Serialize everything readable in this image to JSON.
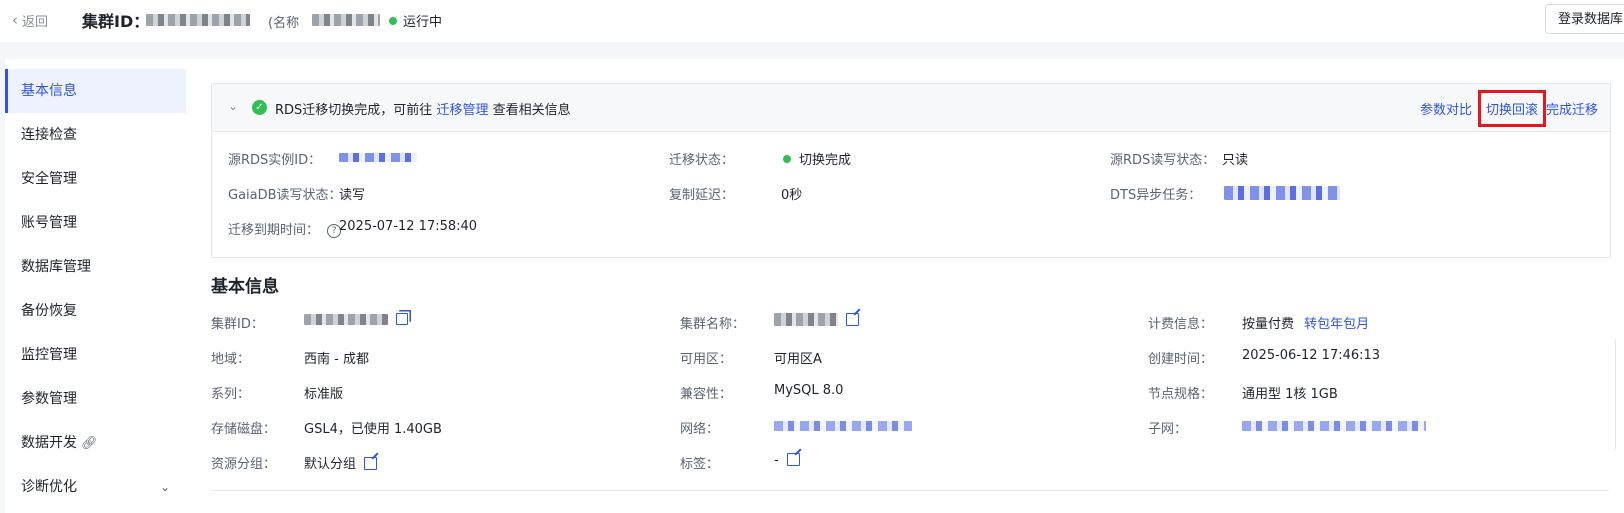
{
  "header": {
    "back_label": "返回",
    "cluster_id_label": "集群ID：",
    "name_label": "(名称",
    "status": "运行中",
    "login_db_button": "登录数据库"
  },
  "sidebar": {
    "items": [
      {
        "label": "基本信息",
        "active": true
      },
      {
        "label": "连接检查"
      },
      {
        "label": "安全管理"
      },
      {
        "label": "账号管理"
      },
      {
        "label": "数据库管理"
      },
      {
        "label": "备份恢复"
      },
      {
        "label": "监控管理"
      },
      {
        "label": "参数管理"
      },
      {
        "label": "数据开发"
      },
      {
        "label": "诊断优化"
      }
    ]
  },
  "migration": {
    "message_prefix": "RDS迁移切换完成，可前往",
    "message_link": "迁移管理",
    "message_suffix": "查看相关信息",
    "actions": {
      "param_compare": "参数对比",
      "switch_rollback": "切换回滚",
      "complete_migration": "完成迁移"
    },
    "fields": {
      "source_rds_id_label": "源RDS实例ID：",
      "migration_status_label": "迁移状态：",
      "migration_status_value": "切换完成",
      "source_rw_status_label": "源RDS读写状态：",
      "source_rw_status_value": "只读",
      "gaiadb_rw_status_label": "GaiaDB读写状态：",
      "gaiadb_rw_status_value": "读写",
      "replication_delay_label": "复制延迟：",
      "replication_delay_value": "0秒",
      "dts_task_label": "DTS异步任务：",
      "expire_time_label": "迁移到期时间：",
      "expire_time_value": "2025-07-12 17:58:40"
    }
  },
  "basic_info": {
    "title": "基本信息",
    "cluster_id_label": "集群ID：",
    "cluster_name_label": "集群名称：",
    "billing_label": "计费信息：",
    "billing_value": "按量付费",
    "billing_link": "转包年包月",
    "region_label": "地域：",
    "region_value": "西南 - 成都",
    "zone_label": "可用区：",
    "zone_value": "可用区A",
    "created_label": "创建时间：",
    "created_value": "2025-06-12 17:46:13",
    "series_label": "系列：",
    "series_value": "标准版",
    "compat_label": "兼容性：",
    "compat_value": "MySQL 8.0",
    "spec_label": "节点规格：",
    "spec_value": "通用型 1核 1GB",
    "storage_label": "存储磁盘：",
    "storage_value": "GSL4，已使用 1.40GB",
    "network_label": "网络：",
    "subnet_label": "子网：",
    "resource_group_label": "资源分组：",
    "resource_group_value": "默认分组",
    "tags_label": "标签：",
    "tags_value": "-"
  },
  "colors": {
    "accent": "#2f54eb",
    "success": "#30bf55",
    "highlight": "#e8151b"
  }
}
